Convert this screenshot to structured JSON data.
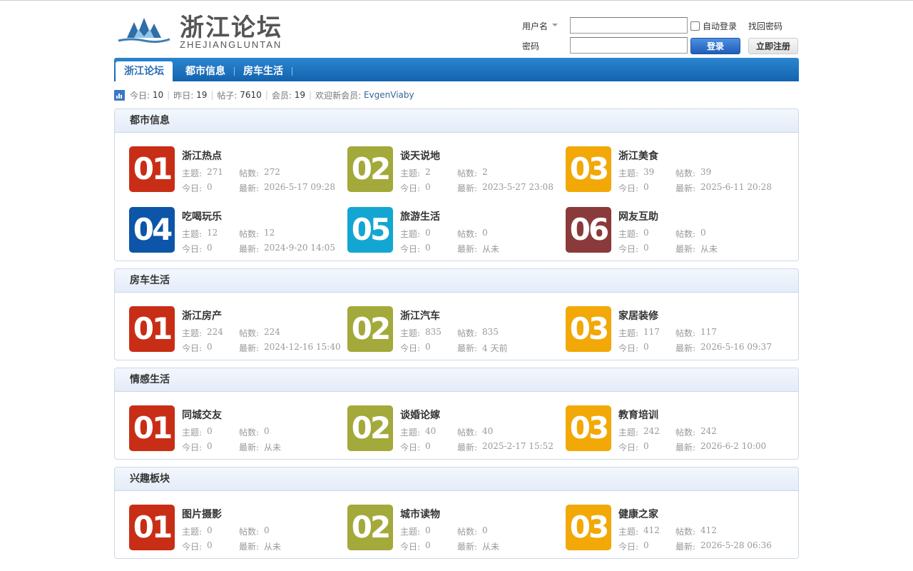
{
  "site": {
    "logo_cn": "浙江论坛",
    "logo_en": "ZHEJIANGLUNTAN"
  },
  "login": {
    "username_label": "用户名",
    "password_label": "密码",
    "auto_login": "自动登录",
    "forgot": "找回密码",
    "login_button": "登录",
    "register_button": "立即注册"
  },
  "nav": [
    {
      "label": "浙江论坛"
    },
    {
      "label": "都市信息"
    },
    {
      "label": "房车生活"
    }
  ],
  "stats": {
    "today_label": "今日:",
    "today": "10",
    "yesterday_label": "昨日:",
    "yesterday": "19",
    "posts_label": "帖子:",
    "posts": "7610",
    "members_label": "会员:",
    "members": "19",
    "welcome_label": "欢迎新会员:",
    "newest_member": "EvgenViaby"
  },
  "labels": {
    "topics": "主题:",
    "posts": "帖数:",
    "today": "今日:",
    "latest": "最新:"
  },
  "colors": {
    "red": "#c82e16",
    "olive": "#a3a93a",
    "amber": "#f2a806",
    "blue": "#0d55a8",
    "cyan": "#14a6d2",
    "maroon": "#8a3a3a"
  },
  "sections": [
    {
      "title": "都市信息",
      "forums": [
        {
          "num": "01",
          "name": "浙江热点",
          "topics": "271",
          "posts": "272",
          "today": "0",
          "latest": "2026-5-17 09:28"
        },
        {
          "num": "02",
          "name": "谈天说地",
          "topics": "2",
          "posts": "2",
          "today": "0",
          "latest": "2023-5-27 23:08"
        },
        {
          "num": "03",
          "name": "浙江美食",
          "topics": "39",
          "posts": "39",
          "today": "0",
          "latest": "2025-6-11 20:28"
        },
        {
          "num": "04",
          "name": "吃喝玩乐",
          "topics": "12",
          "posts": "12",
          "today": "0",
          "latest": "2024-9-20 14:05"
        },
        {
          "num": "05",
          "name": "旅游生活",
          "topics": "0",
          "posts": "0",
          "today": "0",
          "latest": "从未"
        },
        {
          "num": "06",
          "name": "网友互助",
          "topics": "0",
          "posts": "0",
          "today": "0",
          "latest": "从未"
        }
      ]
    },
    {
      "title": "房车生活",
      "forums": [
        {
          "num": "01",
          "name": "浙江房产",
          "topics": "224",
          "posts": "224",
          "today": "0",
          "latest": "2024-12-16 15:40"
        },
        {
          "num": "02",
          "name": "浙江汽车",
          "topics": "835",
          "posts": "835",
          "today": "0",
          "latest": "4 天前"
        },
        {
          "num": "03",
          "name": "家居装修",
          "topics": "117",
          "posts": "117",
          "today": "0",
          "latest": "2026-5-16 09:37"
        }
      ]
    },
    {
      "title": "情感生活",
      "forums": [
        {
          "num": "01",
          "name": "同城交友",
          "topics": "0",
          "posts": "0",
          "today": "0",
          "latest": "从未"
        },
        {
          "num": "02",
          "name": "谈婚论嫁",
          "topics": "40",
          "posts": "40",
          "today": "0",
          "latest": "2025-2-17 15:52"
        },
        {
          "num": "03",
          "name": "教育培训",
          "topics": "242",
          "posts": "242",
          "today": "0",
          "latest": "2026-6-2 10:00"
        }
      ]
    },
    {
      "title": "兴趣板块",
      "forums": [
        {
          "num": "01",
          "name": "图片摄影",
          "topics": "0",
          "posts": "0",
          "today": "0",
          "latest": "从未"
        },
        {
          "num": "02",
          "name": "城市读物",
          "topics": "0",
          "posts": "0",
          "today": "0",
          "latest": "从未"
        },
        {
          "num": "03",
          "name": "健康之家",
          "topics": "412",
          "posts": "412",
          "today": "0",
          "latest": "2026-5-28 06:36"
        }
      ]
    }
  ]
}
